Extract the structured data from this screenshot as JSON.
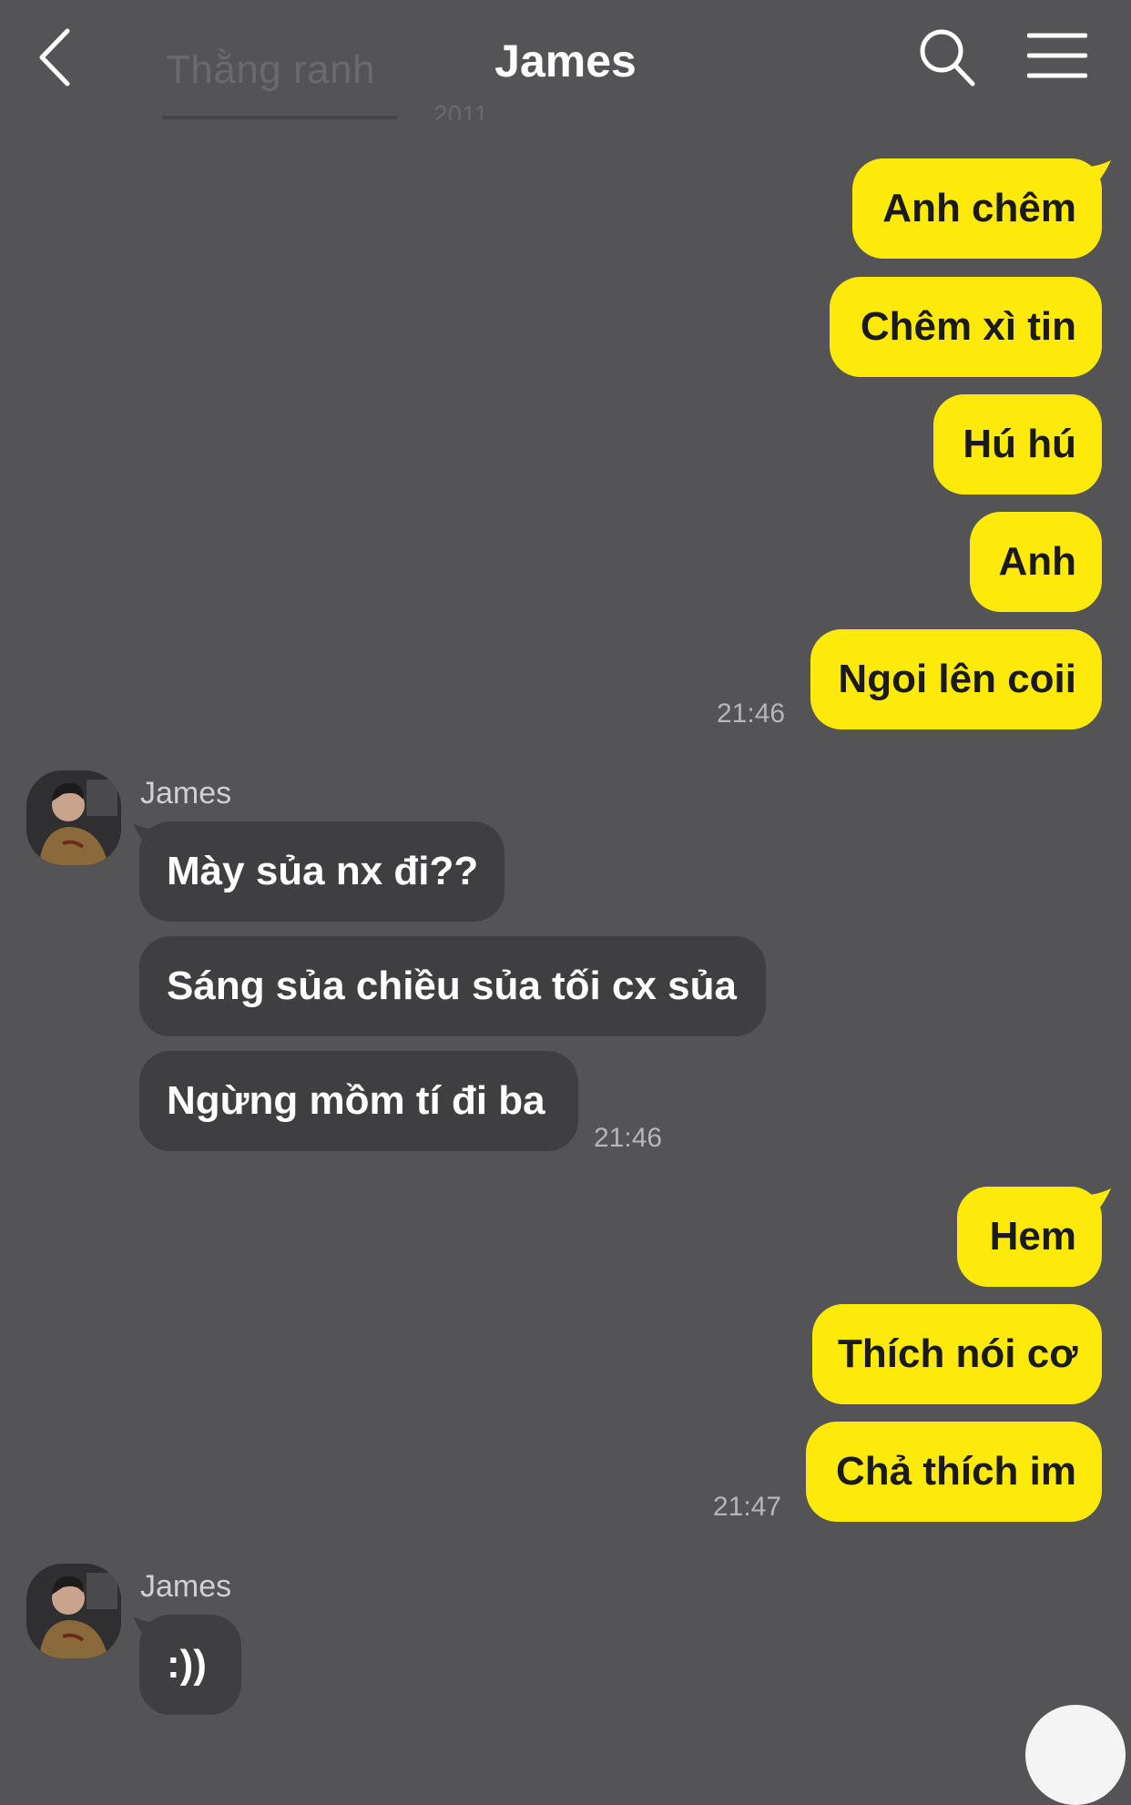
{
  "header": {
    "title": "James",
    "faded_label": "Thằng ranh",
    "faded_time": "2011"
  },
  "messages": {
    "group1": [
      "Anh chêm",
      "Chêm xì tin",
      "Hú hú",
      "Anh",
      "Ngoi lên coii"
    ],
    "group1_time": "21:46",
    "group2_sender": "James",
    "group2": [
      "Mày sủa nx đi??",
      "Sáng sủa chiều sủa tối cx sủa",
      "Ngừng mồm tí đi ba"
    ],
    "group2_time": "21:46",
    "group3": [
      "Hem",
      "Thích nói cơ",
      "Chả thích im"
    ],
    "group3_time": "21:47",
    "group4_sender": "James",
    "group4": [
      ":))"
    ]
  },
  "colors": {
    "background": "#545356",
    "outgoing_bubble": "#fdea0a",
    "incoming_bubble": "#3f3e41"
  },
  "icons": {
    "back": "chevron-left-icon",
    "search": "search-icon",
    "menu": "menu-icon"
  }
}
